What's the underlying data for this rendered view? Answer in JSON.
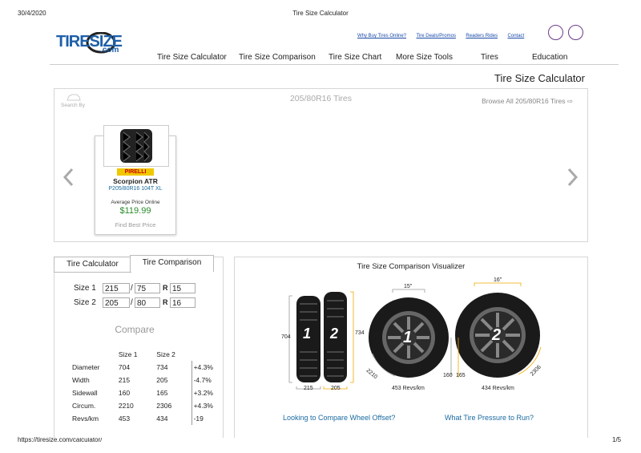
{
  "print_header": {
    "date": "30/4/2020",
    "title": "Tire Size Calculator"
  },
  "print_footer": {
    "url": "https://tiresize.com/calculator/",
    "page": "1/5"
  },
  "logo": {
    "text_main": "TIRESIZE",
    "text_sub": ".com"
  },
  "top_links": [
    "Why Buy Tires Online?",
    "Tire Deals/Promos",
    "Readers Rides",
    "Contact"
  ],
  "nav": [
    "Tire Size Calculator",
    "Tire Size Comparison",
    "Tire Size Chart",
    "More Size Tools",
    "Tires",
    "Education"
  ],
  "page_title": "Tire Size Calculator",
  "carousel": {
    "search_by": "Search By",
    "size_title": "205/80R16 Tires",
    "browse_link": "Browse All 205/80R16 Tires ⇨",
    "product": {
      "brand": "PIRELLI",
      "name": "Scorpion ATR",
      "size": "P205/80R16 104T XL",
      "price_label": "Average Price Online",
      "price": "$119.99",
      "find_best": "Find Best Price"
    }
  },
  "calculator": {
    "tabs": [
      "Tire Calculator",
      "Tire Comparison"
    ],
    "size1": {
      "label": "Size 1",
      "width": "215",
      "aspect": "75",
      "r": "R",
      "rim": "15"
    },
    "size2": {
      "label": "Size 2",
      "width": "205",
      "aspect": "80",
      "r": "R",
      "rim": "16"
    },
    "slash": "/",
    "compare_label": "Compare",
    "headers": [
      "",
      "Size 1",
      "Size 2",
      ""
    ],
    "rows": [
      [
        "Diameter",
        "704",
        "734",
        "+4.3%"
      ],
      [
        "Width",
        "215",
        "205",
        "-4.7%"
      ],
      [
        "Sidewall",
        "160",
        "165",
        "+3.2%"
      ],
      [
        "Circum.",
        "2210",
        "2306",
        "+4.3%"
      ],
      [
        "Revs/km",
        "453",
        "434",
        "-19"
      ]
    ]
  },
  "visualizer": {
    "title": "Tire Size Comparison Visualizer",
    "left_height": "704",
    "right_height": "734",
    "tire1_label": "1",
    "tire2_label": "2",
    "width1": "215",
    "width2": "205",
    "rim1": "15\"",
    "rim2": "16\"",
    "circ1": "2210",
    "side1": "160",
    "side2": "165",
    "circ2": "2306",
    "revs1": "453 Revs/km",
    "revs2": "434 Revs/km",
    "link1": "Looking to Compare Wheel Offset?",
    "link2": "What Tire Pressure to Run?"
  },
  "colors": {
    "accent_blue": "#1a6aa0",
    "price_green": "#2a8a2a",
    "gold": "#f0a800",
    "logo_blue": "#1e5fa8"
  }
}
